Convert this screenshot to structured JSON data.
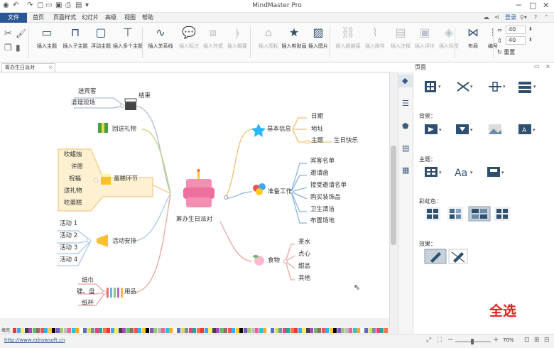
{
  "window": {
    "title": "MindMaster Pro"
  },
  "menu": {
    "items": [
      "文件",
      "首页",
      "页面样式",
      "幻灯片",
      "高级",
      "视图",
      "帮助"
    ],
    "login": "登录"
  },
  "ribbon": {
    "buttons": [
      {
        "label": "插入主题",
        "icon": "topic-icon",
        "enabled": true
      },
      {
        "label": "插入子主题",
        "icon": "subtopic-icon",
        "enabled": true
      },
      {
        "label": "浮动主题",
        "icon": "floating-topic-icon",
        "enabled": true
      },
      {
        "label": "插入多个主题",
        "icon": "multi-topic-icon",
        "enabled": true
      },
      {
        "label": "插入关系线",
        "icon": "relationship-icon",
        "enabled": true
      },
      {
        "label": "插入标注",
        "icon": "callout-icon",
        "enabled": false
      },
      {
        "label": "插入外框",
        "icon": "boundary-icon",
        "enabled": false
      },
      {
        "label": "插入概要",
        "icon": "summary-icon",
        "enabled": false
      },
      {
        "label": "插入图标",
        "icon": "icon-insert-icon",
        "enabled": false
      },
      {
        "label": "插入剪贴画",
        "icon": "clipart-icon",
        "enabled": true
      },
      {
        "label": "插入图片",
        "icon": "picture-icon",
        "enabled": true
      },
      {
        "label": "插入超链接",
        "icon": "hyperlink-icon",
        "enabled": false
      },
      {
        "label": "插入附件",
        "icon": "attachment-icon",
        "enabled": false
      },
      {
        "label": "插入注释",
        "icon": "note-icon",
        "enabled": false
      },
      {
        "label": "插入评论",
        "icon": "comment-icon",
        "enabled": false
      },
      {
        "label": "插入标签",
        "icon": "tag-icon",
        "enabled": false
      },
      {
        "label": "布局",
        "icon": "layout-icon",
        "enabled": true
      },
      {
        "label": "编号",
        "icon": "numbering-icon",
        "enabled": true
      }
    ],
    "spacing_h": "40",
    "spacing_v": "40",
    "reset_label": "重置"
  },
  "document": {
    "tab": "筹办生日派对"
  },
  "mindmap": {
    "central": "筹办生日派对",
    "branches": {
      "end": {
        "label": "结束",
        "children": [
          "送宾客",
          "清理现场"
        ]
      },
      "gift": {
        "label": "回送礼物"
      },
      "cake": {
        "label": "蛋糕环节",
        "children": [
          "吹蜡烛",
          "许愿",
          "祝福",
          "送礼物",
          "吃蛋糕"
        ]
      },
      "activity": {
        "label": "活动安排",
        "children": [
          "活动 1",
          "活动 2",
          "活动 3",
          "活动 4"
        ]
      },
      "supplies": {
        "label": "用品",
        "children": [
          "纸巾",
          "碟、盘",
          "纸杯"
        ]
      },
      "info": {
        "label": "基本信息",
        "children": [
          "日期",
          "地址",
          "主题"
        ],
        "theme_value": "生日快乐"
      },
      "prep": {
        "label": "准备工作",
        "children": [
          "宾客名单",
          "邀请函",
          "接受邀请名单",
          "购买装饰品",
          "卫生清洁",
          "布置场地"
        ]
      },
      "food": {
        "label": "食物",
        "children": [
          "茶水",
          "点心",
          "甜品",
          "其他"
        ]
      }
    }
  },
  "panel": {
    "title": "页面",
    "sections": {
      "background": "背景：",
      "theme": "主题：",
      "rainbow": "彩虹色：",
      "effect": "效果："
    },
    "overlay": "全选"
  },
  "status": {
    "url": "http://www.edrawsoft.cn",
    "zoom": "70%",
    "fill_label": "填充"
  },
  "colors": {
    "accent": "#2b5797",
    "overlay": "#e02020",
    "end_line": "#a7bed6",
    "cake_fill": "#fdf1d2",
    "info_line": "#f0c070",
    "prep_line": "#8ab4dd",
    "food_line": "#e9a7a1"
  }
}
